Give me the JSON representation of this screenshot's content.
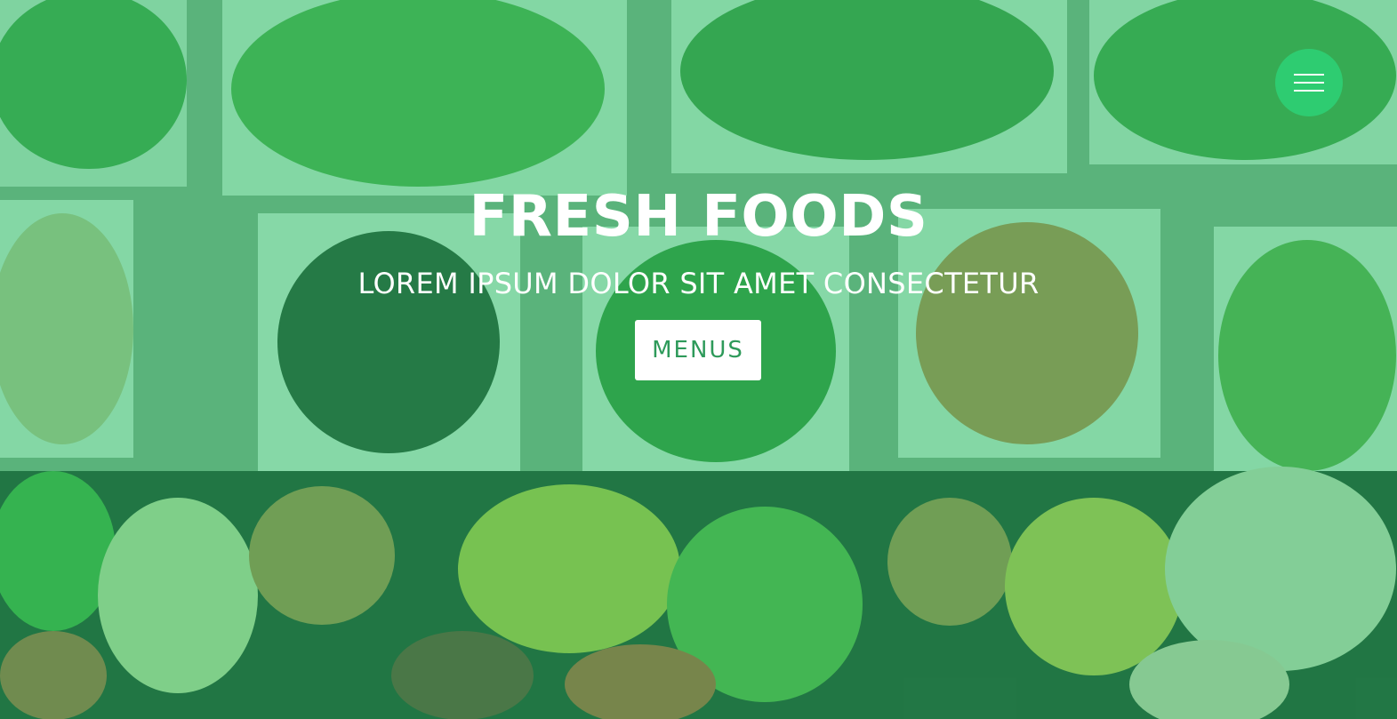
{
  "hero": {
    "title": "FRESH FOODS",
    "subtitle": "LOREM IPSUM DOLOR SIT AMET CONSECTETUR",
    "cta_label": "MENUS",
    "overlay_color": "#2ecc71"
  },
  "nav": {
    "toggle_icon": "hamburger-menu-icon",
    "toggle_color": "#2ecc71"
  }
}
